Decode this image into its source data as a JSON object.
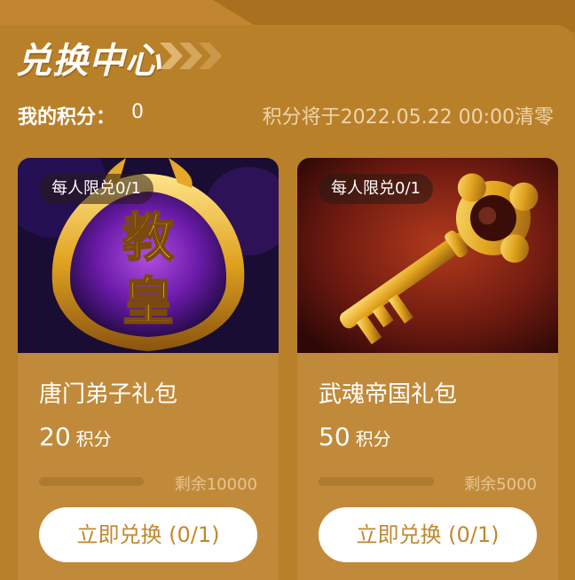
{
  "header": {
    "title": "兑换中心",
    "points_label": "我的积分：",
    "points_value": "0",
    "expire_notice": "积分将于2022.05.22 00:00清零"
  },
  "cards": [
    {
      "image": "pope-badge-image",
      "image_text_line1": "教",
      "image_text_line2": "皇",
      "limit": "每人限兑0/1",
      "name": "唐门弟子礼包",
      "price": "20",
      "price_unit": "积分",
      "remaining": "剩余10000",
      "stock_fraction": 0.0,
      "button": "立即兑换 (0/1)"
    },
    {
      "image": "golden-key-image",
      "limit": "每人限兑0/1",
      "name": "武魂帝国礼包",
      "price": "50",
      "price_unit": "积分",
      "remaining": "剩余5000",
      "stock_fraction": 0.0,
      "button": "立即兑换 (0/1)"
    }
  ],
  "colors": {
    "background": "#b9802a",
    "card": "#c18a3a",
    "button_text": "#c2872f",
    "white": "#ffffff"
  }
}
